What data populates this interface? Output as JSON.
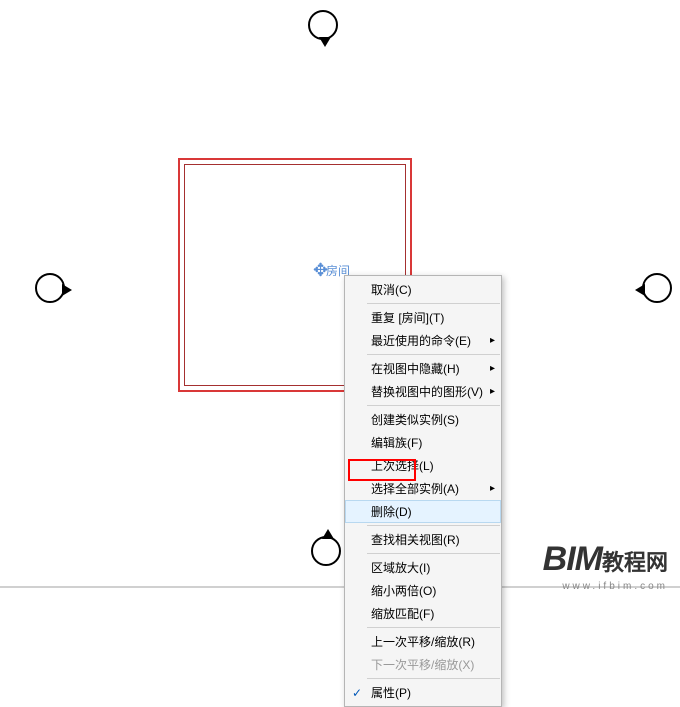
{
  "room": {
    "label": "房间"
  },
  "menu": {
    "cancel": "取消(C)",
    "repeat": "重复 [房间](T)",
    "recent": "最近使用的命令(E)",
    "hide": "在视图中隐藏(H)",
    "override": "替换视图中的图形(V)",
    "similar": "创建类似实例(S)",
    "editfam": "编辑族(F)",
    "lastsel": "上次选择(L)",
    "selall": "选择全部实例(A)",
    "delete": "删除(D)",
    "findrel": "查找相关视图(R)",
    "zoomin": "区域放大(I)",
    "zoomout": "缩小两倍(O)",
    "zoomfit": "缩放匹配(F)",
    "prevpan": "上一次平移/缩放(R)",
    "nextpan": "下一次平移/缩放(X)",
    "props": "属性(P)"
  },
  "logo": {
    "brand": "BIM",
    "suffix": "教程网",
    "url": "www.ifbim.com"
  }
}
